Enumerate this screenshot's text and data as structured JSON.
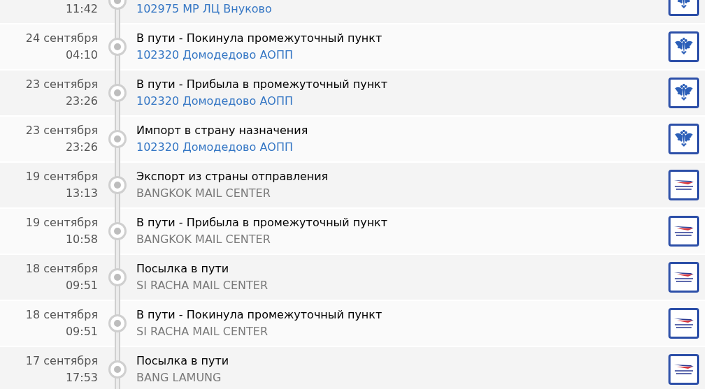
{
  "events": [
    {
      "kind": "russian_post",
      "time": "11:42",
      "location": "102975 МР ЛЦ Внуково"
    },
    {
      "kind": "russian_post",
      "date": "24 сентября",
      "time": "04:10",
      "status": "В пути - Покинула промежуточный пункт",
      "location": "102320 Домодедово АОПП"
    },
    {
      "kind": "russian_post",
      "date": "23 сентября",
      "time": "23:26",
      "status": "В пути - Прибыла в промежуточный пункт",
      "location": "102320 Домодедово АОПП"
    },
    {
      "kind": "russian_post",
      "date": "23 сентября",
      "time": "23:26",
      "status": "Импорт в страну назначения",
      "location": "102320 Домодедово АОПП"
    },
    {
      "kind": "thailand_post",
      "date": "19 сентября",
      "time": "13:13",
      "status": "Экспорт из страны отправления",
      "location": "BANGKOK MAIL CENTER"
    },
    {
      "kind": "thailand_post",
      "date": "19 сентября",
      "time": "10:58",
      "status": "В пути - Прибыла в промежуточный пункт",
      "location": "BANGKOK MAIL CENTER"
    },
    {
      "kind": "thailand_post",
      "date": "18 сентября",
      "time": "09:51",
      "status": "Посылка в пути",
      "location": "SI RACHA MAIL CENTER"
    },
    {
      "kind": "thailand_post",
      "date": "18 сентября",
      "time": "09:51",
      "status": "В пути - Покинула промежуточный пункт",
      "location": "SI RACHA MAIL CENTER"
    },
    {
      "kind": "thailand_post",
      "date": "17 сентября",
      "time": "17:53",
      "status": "Посылка в пути",
      "location": "BANG LAMUNG"
    }
  ]
}
